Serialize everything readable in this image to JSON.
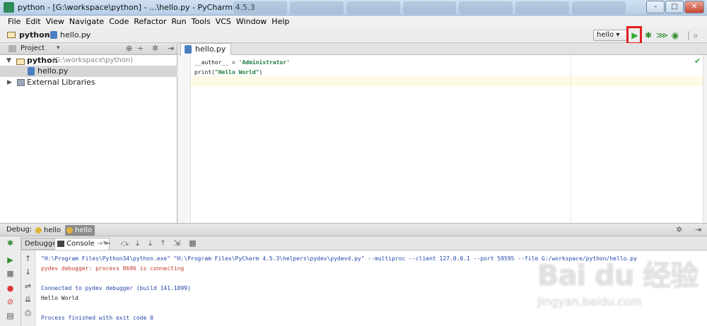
{
  "window": {
    "title": "python - [G:\\workspace\\python] - ...\\hello.py - PyCharm 4.5.3",
    "min": "–",
    "max": "□",
    "close": "✕"
  },
  "menu": [
    "File",
    "Edit",
    "View",
    "Navigate",
    "Code",
    "Refactor",
    "Run",
    "Tools",
    "VCS",
    "Window",
    "Help"
  ],
  "nav": {
    "project": "python",
    "file": "hello.py",
    "run_config": "hello",
    "run_icon_color": "#2eaa2e",
    "highlight_color": "#e02020"
  },
  "project_panel": {
    "title": "Project",
    "root_name": "python",
    "root_path": "(G:\\workspace\\python)",
    "file": "hello.py",
    "external": "External Libraries"
  },
  "editor": {
    "tab": "hello.py",
    "line1_var": "__author__ = ",
    "line1_str": "'Administrator'",
    "line2_pre": "print(",
    "line2_str": "\"Hello World\"",
    "line2_post": ")"
  },
  "debug": {
    "label": "Debug:",
    "tab1": "hello",
    "tab2": "hello",
    "debugger_tab": "Debugger",
    "console_tab": "Console"
  },
  "console": {
    "cmd": "\"H:\\Program Files\\Python34\\python.exe\" \"H:\\Program Files\\PyCharm 4.5.3\\helpers\\pydev\\pydevd.py\" --multiproc --client 127.0.0.1 --port 59595 --file G:/workspace/python/hello.py",
    "connecting": "pydev debugger: process 8696 is connecting",
    "connected": "Connected to pydev debugger (build 141.1899)",
    "output": "Hello World",
    "finished": "Process finished with exit code 0"
  },
  "watermark": {
    "logo": "Bai du 经验",
    "url": "jingyan.baidu.com"
  }
}
